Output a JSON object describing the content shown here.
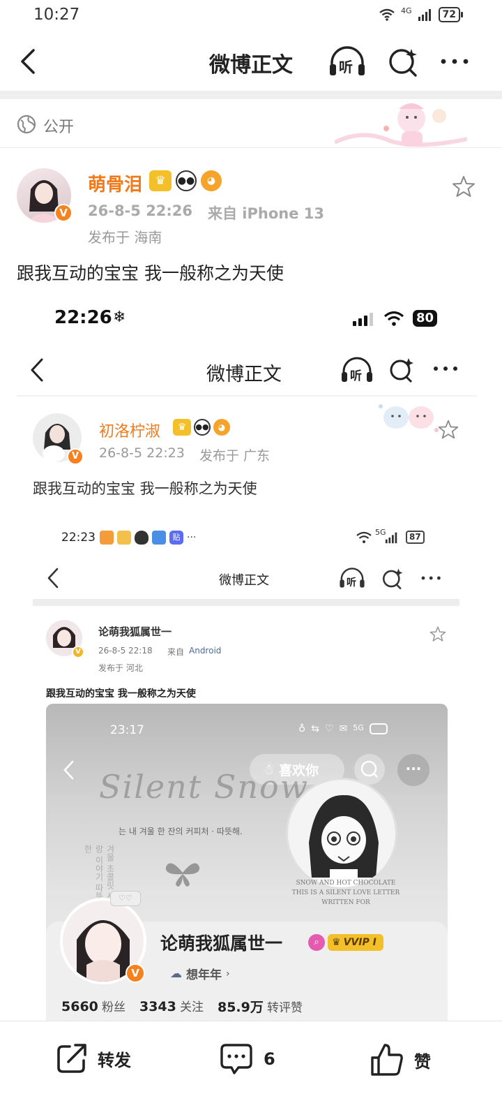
{
  "status_bar": {
    "time": "10:27",
    "network": "4G",
    "battery": "72"
  },
  "nav": {
    "title": "微博正文",
    "listen_label": "听"
  },
  "visibility": {
    "label": "公开"
  },
  "post": {
    "author": "萌骨泪",
    "timestamp": "26-8-5 22:26",
    "source": "来自 iPhone 13",
    "location": "发布于 海南",
    "text": "跟我互动的宝宝 我一般称之为天使"
  },
  "embedded_1": {
    "status_time": "22:26",
    "battery": "80",
    "nav_title": "微博正文",
    "listen_label": "听",
    "author": "初洛柠淑",
    "timestamp": "26-8-5 22:23",
    "location": "发布于 广东",
    "text": "跟我互动的宝宝 我一般称之为天使"
  },
  "embedded_2": {
    "status_time": "22:23",
    "battery": "87",
    "network": "5G",
    "app_badge": "贴",
    "nav_title": "微博正文",
    "listen_label": "听",
    "author": "论萌我狐属世一",
    "timestamp": "26-8-5 22:18",
    "source_prefix": "来自",
    "source": "Android",
    "location": "发布于 河北",
    "text": "跟我互动的宝宝 我一般称之为天使"
  },
  "embedded_3": {
    "status_time": "23:17",
    "network": "5G",
    "like_button": "喜欢你",
    "banner_script": "Silent Snow",
    "korean_line": "는 내 겨울 한 잔의 커피처 · 따뜻해.",
    "english_line_1": "SNOW AND HOT CHOCOLATE",
    "english_line_2": "THIS IS A SILENT LOVE LETTER",
    "english_line_3": "WRITTEN FOR",
    "vertical_text": "겨울 초콜릿 사랑 이야기 따뜻한",
    "profile_name": "论萌我狐属世一",
    "vip_label": "VVIP I",
    "bio": "想年年",
    "stats": [
      {
        "value": "5660",
        "label": "粉丝"
      },
      {
        "value": "3343",
        "label": "关注"
      },
      {
        "value": "85.9万",
        "label": "转评赞"
      }
    ]
  },
  "toolbar": {
    "repost": "转发",
    "comment_count": "6",
    "like": "赞"
  },
  "colors": {
    "accent": "#f27a1a",
    "vip_gold": "#f3c02a",
    "verified": "#f5811f"
  }
}
